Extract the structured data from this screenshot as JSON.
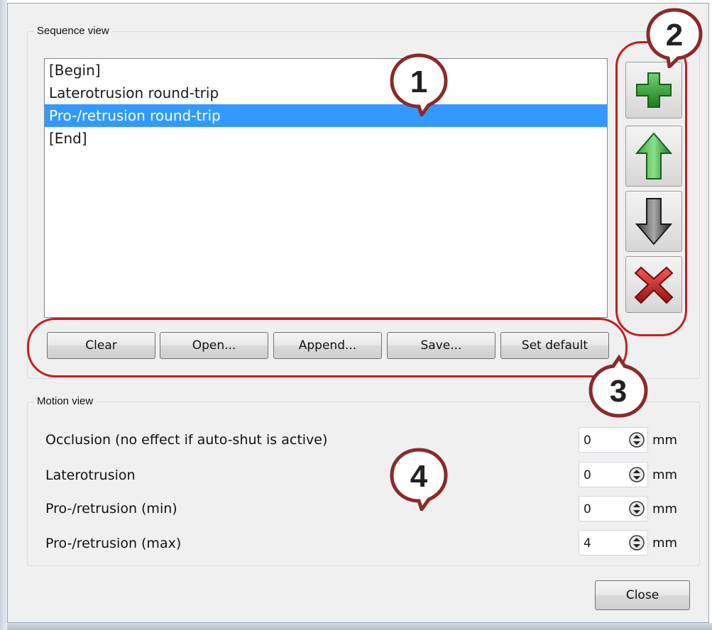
{
  "sequence_view": {
    "title": "Sequence view",
    "items": [
      {
        "label": "[Begin]",
        "selected": false
      },
      {
        "label": "Laterotrusion round-trip",
        "selected": false
      },
      {
        "label": "Pro-/retrusion round-trip",
        "selected": true
      },
      {
        "label": "[End]",
        "selected": false
      }
    ],
    "buttons": {
      "clear": "Clear",
      "open": "Open...",
      "append": "Append...",
      "save": "Save...",
      "set_default": "Set default"
    },
    "tools": {
      "add": "plus-icon",
      "move_up": "arrow-up-icon",
      "move_down": "arrow-down-icon",
      "delete": "delete-icon"
    }
  },
  "motion_view": {
    "title": "Motion view",
    "rows": [
      {
        "label": "Occlusion (no effect if auto-shut is active)",
        "value": "0",
        "unit": "mm"
      },
      {
        "label": "Laterotrusion",
        "value": "0",
        "unit": "mm"
      },
      {
        "label": "Pro-/retrusion (min)",
        "value": "0",
        "unit": "mm"
      },
      {
        "label": "Pro-/retrusion (max)",
        "value": "4",
        "unit": "mm"
      }
    ]
  },
  "close_button": "Close",
  "callouts": {
    "c1": "1",
    "c2": "2",
    "c3": "3",
    "c4": "4"
  },
  "colors": {
    "selection": "#3399ff",
    "annotation_red": "#c41f1f",
    "add_green": "#2f9e2f",
    "delete_red": "#c62020"
  }
}
